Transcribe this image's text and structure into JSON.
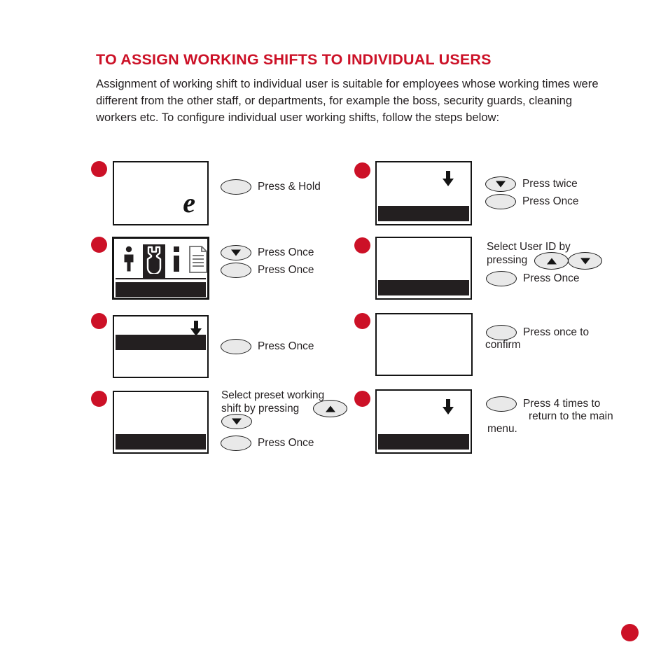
{
  "heading": {
    "title": "TO ASSIGN WORKING SHIFTS TO INDIVIDUAL USERS",
    "color": "#cc1127"
  },
  "intro": {
    "paragraph": "Assignment of working shift to individual user is suitable for employees whose working times were different from the other staff, or departments, for example the boss, security guards, cleaning workers etc. To configure individual user working shifts, follow the steps below:"
  },
  "steps": [
    {
      "id": 1,
      "column": "left",
      "screen": {
        "content": "e-logo",
        "logo_text": "e",
        "has_bar": false,
        "has_arrow": false
      },
      "actions": [
        {
          "button": "enter-oval",
          "icon": "none",
          "label": "Press & Hold"
        }
      ]
    },
    {
      "id": 2,
      "column": "left",
      "screen": {
        "content": "menu-icons",
        "icons": [
          "user-icon",
          "wrench-icon",
          "info-icon",
          "document-icon"
        ],
        "selected_icon": "wrench-icon",
        "has_bar": true,
        "has_rule": true,
        "has_arrow": false
      },
      "actions": [
        {
          "button": "down-oval",
          "icon": "triangle-down",
          "label": "Press Once"
        },
        {
          "button": "enter-oval",
          "icon": "none",
          "label": "Press Once"
        }
      ]
    },
    {
      "id": 3,
      "column": "left",
      "screen": {
        "content": "highlight-bar-upper",
        "has_bar": true,
        "has_arrow": true
      },
      "actions": [
        {
          "button": "enter-oval",
          "icon": "none",
          "label": "Press Once"
        }
      ]
    },
    {
      "id": 4,
      "column": "left",
      "screen": {
        "content": "highlight-bar-lower",
        "has_bar": true,
        "has_arrow": false
      },
      "actions": [
        {
          "button": "up-oval",
          "icon": "triangle-up",
          "label": ""
        },
        {
          "button": "down-oval",
          "icon": "triangle-down",
          "label": ""
        },
        {
          "button": "enter-oval",
          "icon": "none",
          "label": "Press Once"
        }
      ],
      "text_lines": [
        "Select preset working",
        "shift by pressing"
      ]
    },
    {
      "id": 5,
      "column": "right",
      "screen": {
        "content": "highlight-bar-lower",
        "has_bar": true,
        "has_arrow": true
      },
      "actions": [
        {
          "button": "down-oval",
          "icon": "triangle-down",
          "label": "Press  twice"
        },
        {
          "button": "enter-oval",
          "icon": "none",
          "label": "Press Once"
        }
      ]
    },
    {
      "id": 6,
      "column": "right",
      "screen": {
        "content": "highlight-bar-lower",
        "has_bar": true,
        "has_arrow": false
      },
      "actions": [
        {
          "button": "up-oval",
          "icon": "triangle-up",
          "label": ""
        },
        {
          "button": "down-oval",
          "icon": "triangle-down",
          "label": ""
        },
        {
          "button": "enter-oval",
          "icon": "none",
          "label": "Press Once"
        }
      ],
      "text_lines": [
        "Select User ID by",
        "pressing"
      ]
    },
    {
      "id": 7,
      "column": "right",
      "screen": {
        "content": "blank",
        "has_bar": false,
        "has_arrow": false
      },
      "actions": [
        {
          "button": "enter-oval",
          "icon": "none",
          "label": "Press once to"
        }
      ],
      "text_lines": [
        "confirm"
      ]
    },
    {
      "id": 8,
      "column": "right",
      "screen": {
        "content": "highlight-bar-lower",
        "has_bar": true,
        "has_arrow": true
      },
      "actions": [
        {
          "button": "esc-oval",
          "icon": "none",
          "label": "Press 4 times to"
        }
      ],
      "text_lines": [
        "return to the main",
        "menu."
      ]
    }
  ],
  "labels": {
    "press_and_hold": "Press & Hold",
    "press_once": "Press Once",
    "press_twice": "Press  twice",
    "select_preset_l1": "Select preset working",
    "select_preset_l2": "shift by pressing",
    "select_user_l1": "Select User ID by",
    "select_user_l2": "pressing",
    "press_once_to": "Press once to",
    "confirm": "confirm",
    "press_4_times": "Press 4 times to",
    "return_main": "return to the main",
    "menu": "menu."
  },
  "page_marker": {
    "shape": "circle",
    "color": "#cc1127"
  }
}
